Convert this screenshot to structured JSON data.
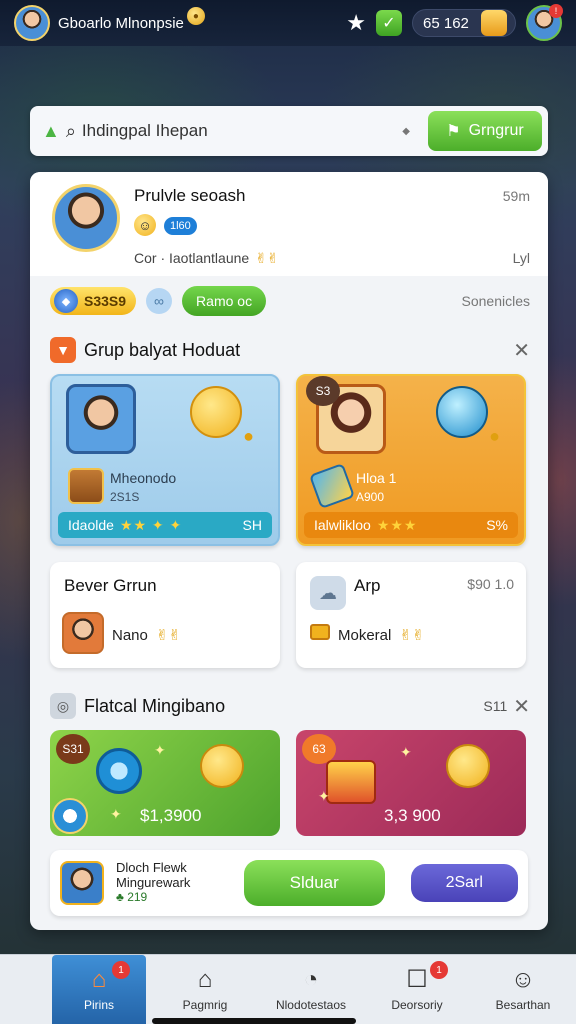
{
  "topbar": {
    "title": "Gboarlo Mlnonpsie",
    "currency": "65 162",
    "notif_count": ""
  },
  "search": {
    "text": "Ihdingpal Ihepan",
    "button_label": "Grngrur"
  },
  "profile": {
    "name": "Prulvle seoash",
    "time": "59m",
    "level": "1l60",
    "subtitle": "Cor · Iaotlantlaune",
    "subtitle_right": "Lyl"
  },
  "stats": {
    "coins": "S33S9",
    "rename_label": "Ramo oc",
    "right": "Sonenicles"
  },
  "section1": {
    "title": "Grup balyat Hoduat",
    "cards": [
      {
        "tag": "",
        "name": "Mheonodo",
        "sub": "2S1S",
        "foot_label": "Idaolde",
        "foot_stars": "★★ ✦ ✦",
        "foot_right": "SH"
      },
      {
        "tag": "S3",
        "name": "Hloa 1",
        "sub": "A900",
        "foot_label": "Ialwlikloo",
        "foot_stars": "★★★",
        "foot_right": "S%"
      }
    ],
    "small_cards": [
      {
        "title": "Bever Grrun",
        "label": "Nano",
        "price": ""
      },
      {
        "title": "Arp",
        "label": "Mokeral",
        "price": "$90 1.0"
      }
    ]
  },
  "section2": {
    "title": "Flatcal Mingibano",
    "right": "S11",
    "promos": [
      {
        "tag": "S31",
        "price": "$1,3900"
      },
      {
        "tag": "63",
        "price": "3,3 900"
      }
    ]
  },
  "footer_row": {
    "line1": "Dloch Flewk",
    "line2": "Mingurewark",
    "sub": "♣ 219",
    "primary_label": "Slduar",
    "secondary_label": "2Sarl"
  },
  "nav": [
    {
      "label": "Pirins",
      "icon": "house-icon",
      "badge": "1"
    },
    {
      "label": "Pagmrig",
      "icon": "home-icon",
      "badge": ""
    },
    {
      "label": "Nlodotestaos",
      "icon": "compass-icon",
      "badge": ""
    },
    {
      "label": "Deorsoriy",
      "icon": "chat-icon",
      "badge": "1"
    },
    {
      "label": "Besarthan",
      "icon": "user-icon",
      "badge": ""
    }
  ],
  "colors": {
    "accent_green": "#4cae2a",
    "accent_blue": "#2464a8",
    "accent_orange": "#f09a22",
    "badge_red": "#e53935"
  }
}
